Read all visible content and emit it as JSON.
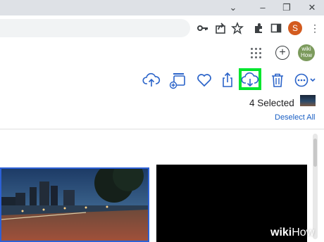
{
  "browser": {
    "window_controls": [
      "chevron-down-icon",
      "minimize-icon",
      "restore-icon",
      "close-icon"
    ],
    "toolbar_icons": [
      "key-icon",
      "share-icon",
      "star-icon",
      "extensions-icon",
      "sidepanel-icon"
    ],
    "profile_initial": "S"
  },
  "appbar": {
    "avatar_text_top": "wiki",
    "avatar_text_bottom": "How"
  },
  "actions": {
    "icons": [
      "upload-icon",
      "add-to-album-icon",
      "favorite-icon",
      "share-icon",
      "download-icon",
      "trash-icon",
      "more-icon"
    ],
    "selected_count_label": "4 Selected",
    "deselect_label": "Deselect All"
  },
  "watermark": {
    "wiki": "wiki",
    "how": "How"
  },
  "colors": {
    "highlight": "#00e62e",
    "accent": "#1a5fc4",
    "selection_border": "#2c60d6"
  }
}
